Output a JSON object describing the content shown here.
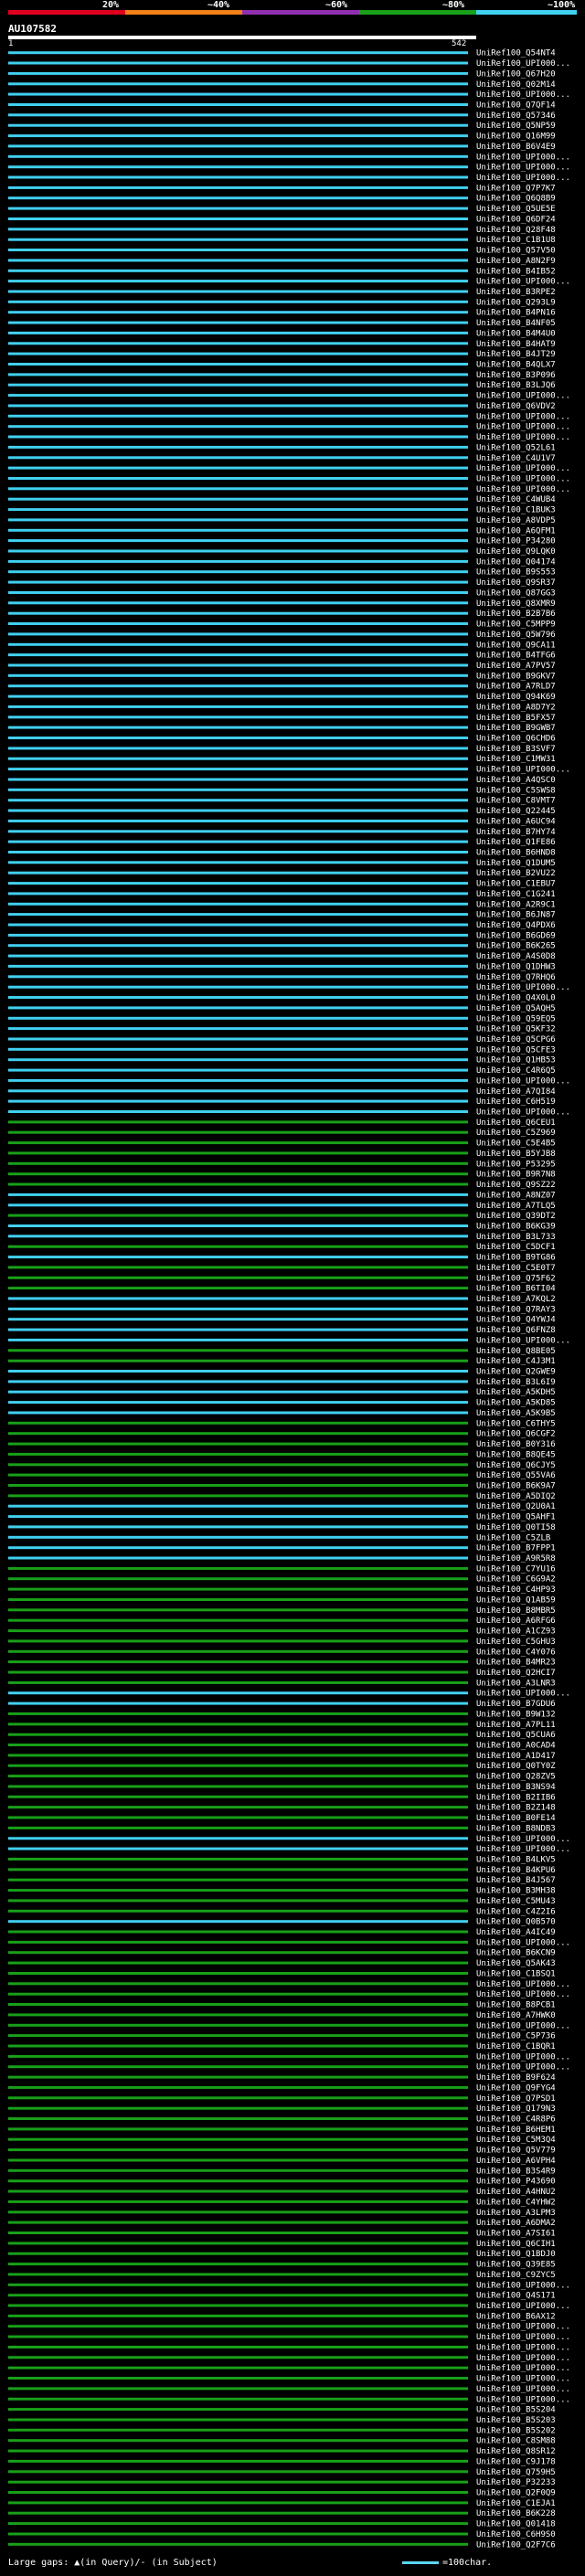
{
  "legend": {
    "ticks": [
      "20%",
      "~40%",
      "~60%",
      "~80%",
      "~100%"
    ],
    "colors": [
      "#e0001e",
      "#f08018",
      "#9030b0",
      "#18a018",
      "#40d0f0"
    ]
  },
  "query": {
    "name": "AU107582",
    "start": "1",
    "end": "542"
  },
  "footer": {
    "gaps": "Large gaps: ▲(in Query)/- (in Subject)",
    "scale": "=100char."
  },
  "hits": [
    {
      "name": "UniRef100_Q54NT4",
      "pct": 100
    },
    {
      "name": "UniRef100_UPI000...",
      "pct": 100
    },
    {
      "name": "UniRef100_Q67H20",
      "pct": 100
    },
    {
      "name": "UniRef100_Q02M14",
      "pct": 100
    },
    {
      "name": "UniRef100_UPI000...",
      "pct": 100
    },
    {
      "name": "UniRef100_Q7QF14",
      "pct": 100
    },
    {
      "name": "UniRef100_Q57346",
      "pct": 100
    },
    {
      "name": "UniRef100_Q5NP59",
      "pct": 100
    },
    {
      "name": "UniRef100_Q16M99",
      "pct": 100
    },
    {
      "name": "UniRef100_B6V4E9",
      "pct": 100
    },
    {
      "name": "UniRef100_UPI000...",
      "pct": 100
    },
    {
      "name": "UniRef100_UPI000...",
      "pct": 100
    },
    {
      "name": "UniRef100_UPI000...",
      "pct": 100
    },
    {
      "name": "UniRef100_Q7P7K7",
      "pct": 100
    },
    {
      "name": "UniRef100_Q6Q8B9",
      "pct": 100
    },
    {
      "name": "UniRef100_Q5UE5E",
      "pct": 100
    },
    {
      "name": "UniRef100_Q6DF24",
      "pct": 100
    },
    {
      "name": "UniRef100_Q28F48",
      "pct": 100
    },
    {
      "name": "UniRef100_C1B1U8",
      "pct": 100
    },
    {
      "name": "UniRef100_Q57V50",
      "pct": 100
    },
    {
      "name": "UniRef100_A8N2F9",
      "pct": 100
    },
    {
      "name": "UniRef100_B4IB52",
      "pct": 100
    },
    {
      "name": "UniRef100_UPI000...",
      "pct": 100
    },
    {
      "name": "UniRef100_B3RPE2",
      "pct": 100
    },
    {
      "name": "UniRef100_Q293L9",
      "pct": 100
    },
    {
      "name": "UniRef100_B4PN16",
      "pct": 100
    },
    {
      "name": "UniRef100_B4NF05",
      "pct": 100
    },
    {
      "name": "UniRef100_B4M4U0",
      "pct": 100
    },
    {
      "name": "UniRef100_B4HAT9",
      "pct": 100
    },
    {
      "name": "UniRef100_B4JT29",
      "pct": 100
    },
    {
      "name": "UniRef100_B4QLX7",
      "pct": 100
    },
    {
      "name": "UniRef100_B3P096",
      "pct": 100
    },
    {
      "name": "UniRef100_B3LJQ6",
      "pct": 100
    },
    {
      "name": "UniRef100_UPI000...",
      "pct": 100
    },
    {
      "name": "UniRef100_Q6VDV2",
      "pct": 100
    },
    {
      "name": "UniRef100_UPI000...",
      "pct": 100
    },
    {
      "name": "UniRef100_UPI000...",
      "pct": 100
    },
    {
      "name": "UniRef100_UPI000...",
      "pct": 100
    },
    {
      "name": "UniRef100_Q52L61",
      "pct": 100
    },
    {
      "name": "UniRef100_C4U1V7",
      "pct": 100
    },
    {
      "name": "UniRef100_UPI000...",
      "pct": 100
    },
    {
      "name": "UniRef100_UPI000...",
      "pct": 100
    },
    {
      "name": "UniRef100_UPI000...",
      "pct": 100
    },
    {
      "name": "UniRef100_C4WUB4",
      "pct": 100
    },
    {
      "name": "UniRef100_C1BUK3",
      "pct": 100
    },
    {
      "name": "UniRef100_A8VDP5",
      "pct": 100
    },
    {
      "name": "UniRef100_A6QFM1",
      "pct": 100
    },
    {
      "name": "UniRef100_P34280",
      "pct": 100
    },
    {
      "name": "UniRef100_Q9LQK0",
      "pct": 100
    },
    {
      "name": "UniRef100_Q04174",
      "pct": 100
    },
    {
      "name": "UniRef100_B9S553",
      "pct": 100
    },
    {
      "name": "UniRef100_Q9SR37",
      "pct": 100
    },
    {
      "name": "UniRef100_Q87GG3",
      "pct": 100
    },
    {
      "name": "UniRef100_Q8XMR9",
      "pct": 100
    },
    {
      "name": "UniRef100_B2B7B6",
      "pct": 100
    },
    {
      "name": "UniRef100_C5MPP9",
      "pct": 100
    },
    {
      "name": "UniRef100_Q5W796",
      "pct": 100
    },
    {
      "name": "UniRef100_Q9CA11",
      "pct": 100
    },
    {
      "name": "UniRef100_B4TFG6",
      "pct": 100
    },
    {
      "name": "UniRef100_A7PV57",
      "pct": 100
    },
    {
      "name": "UniRef100_B9GKV7",
      "pct": 100
    },
    {
      "name": "UniRef100_A7RLD7",
      "pct": 100
    },
    {
      "name": "UniRef100_Q94K69",
      "pct": 100
    },
    {
      "name": "UniRef100_A8D7Y2",
      "pct": 100
    },
    {
      "name": "UniRef100_B5FX57",
      "pct": 100
    },
    {
      "name": "UniRef100_B9GWB7",
      "pct": 100
    },
    {
      "name": "UniRef100_Q6CHD6",
      "pct": 100
    },
    {
      "name": "UniRef100_B3SVF7",
      "pct": 100
    },
    {
      "name": "UniRef100_C1MW31",
      "pct": 100
    },
    {
      "name": "UniRef100_UPI000...",
      "pct": 100
    },
    {
      "name": "UniRef100_A4QSC0",
      "pct": 100
    },
    {
      "name": "UniRef100_C5SWS8",
      "pct": 100
    },
    {
      "name": "UniRef100_C8VMT7",
      "pct": 100
    },
    {
      "name": "UniRef100_Q22445",
      "pct": 100
    },
    {
      "name": "UniRef100_A6UC94",
      "pct": 100
    },
    {
      "name": "UniRef100_B7HY74",
      "pct": 100
    },
    {
      "name": "UniRef100_Q1FE86",
      "pct": 100
    },
    {
      "name": "UniRef100_B6HND8",
      "pct": 100
    },
    {
      "name": "UniRef100_Q1DUM5",
      "pct": 100
    },
    {
      "name": "UniRef100_B2VU22",
      "pct": 100
    },
    {
      "name": "UniRef100_C1EBU7",
      "pct": 100
    },
    {
      "name": "UniRef100_C1G241",
      "pct": 100
    },
    {
      "name": "UniRef100_A2R9C1",
      "pct": 100
    },
    {
      "name": "UniRef100_B6JN87",
      "pct": 100
    },
    {
      "name": "UniRef100_Q4PDX6",
      "pct": 100
    },
    {
      "name": "UniRef100_B6GD69",
      "pct": 100
    },
    {
      "name": "UniRef100_B6K265",
      "pct": 100
    },
    {
      "name": "UniRef100_A4S0D8",
      "pct": 100
    },
    {
      "name": "UniRef100_Q1DHW3",
      "pct": 100
    },
    {
      "name": "UniRef100_Q7RHQ6",
      "pct": 100
    },
    {
      "name": "UniRef100_UPI000...",
      "pct": 100
    },
    {
      "name": "UniRef100_Q4X0L0",
      "pct": 100
    },
    {
      "name": "UniRef100_Q5AQH5",
      "pct": 100
    },
    {
      "name": "UniRef100_Q59EQ5",
      "pct": 100
    },
    {
      "name": "UniRef100_Q5KF32",
      "pct": 100
    },
    {
      "name": "UniRef100_Q5CPG6",
      "pct": 100
    },
    {
      "name": "UniRef100_Q5CFE3",
      "pct": 100
    },
    {
      "name": "UniRef100_Q1HB53",
      "pct": 100
    },
    {
      "name": "UniRef100_C4R6Q5",
      "pct": 100
    },
    {
      "name": "UniRef100_UPI000...",
      "pct": 100
    },
    {
      "name": "UniRef100_A7QI84",
      "pct": 100
    },
    {
      "name": "UniRef100_C6H519",
      "pct": 100
    },
    {
      "name": "UniRef100_UPI000...",
      "pct": 100
    },
    {
      "name": "UniRef100_Q6CEU1",
      "pct": 80
    },
    {
      "name": "UniRef100_C5Z969",
      "pct": 80
    },
    {
      "name": "UniRef100_C5E4B5",
      "pct": 80
    },
    {
      "name": "UniRef100_B5YJB8",
      "pct": 80
    },
    {
      "name": "UniRef100_P53295",
      "pct": 80
    },
    {
      "name": "UniRef100_B9R7N8",
      "pct": 80
    },
    {
      "name": "UniRef100_Q9SZ22",
      "pct": 80
    },
    {
      "name": "UniRef100_A8NZ07",
      "pct": 100
    },
    {
      "name": "UniRef100_A7TLQ5",
      "pct": 100
    },
    {
      "name": "UniRef100_Q39DT2",
      "pct": 80
    },
    {
      "name": "UniRef100_B6KG39",
      "pct": 100
    },
    {
      "name": "UniRef100_B3L733",
      "pct": 100
    },
    {
      "name": "UniRef100_C5DCF1",
      "pct": 80
    },
    {
      "name": "UniRef100_B9TG86",
      "pct": 100
    },
    {
      "name": "UniRef100_C5E0T7",
      "pct": 80
    },
    {
      "name": "UniRef100_Q75F62",
      "pct": 80
    },
    {
      "name": "UniRef100_B6TI04",
      "pct": 80
    },
    {
      "name": "UniRef100_A7KQL2",
      "pct": 100
    },
    {
      "name": "UniRef100_Q7RAY3",
      "pct": 100
    },
    {
      "name": "UniRef100_Q4YWJ4",
      "pct": 100
    },
    {
      "name": "UniRef100_Q6FNZ8",
      "pct": 100
    },
    {
      "name": "UniRef100_UPI000...",
      "pct": 100
    },
    {
      "name": "UniRef100_Q8BE05",
      "pct": 80
    },
    {
      "name": "UniRef100_C4J3M1",
      "pct": 80
    },
    {
      "name": "UniRef100_Q2GWE9",
      "pct": 100
    },
    {
      "name": "UniRef100_B3L6I9",
      "pct": 100
    },
    {
      "name": "UniRef100_A5KDH5",
      "pct": 100
    },
    {
      "name": "UniRef100_A5KD85",
      "pct": 100
    },
    {
      "name": "UniRef100_A5K9B5",
      "pct": 100
    },
    {
      "name": "UniRef100_C6THY5",
      "pct": 80
    },
    {
      "name": "UniRef100_Q6CGF2",
      "pct": 80
    },
    {
      "name": "UniRef100_B0Y316",
      "pct": 80
    },
    {
      "name": "UniRef100_B8QE45",
      "pct": 80
    },
    {
      "name": "UniRef100_Q6CJY5",
      "pct": 80
    },
    {
      "name": "UniRef100_Q55VA6",
      "pct": 80
    },
    {
      "name": "UniRef100_B6K9A7",
      "pct": 80
    },
    {
      "name": "UniRef100_A5DIQ2",
      "pct": 80
    },
    {
      "name": "UniRef100_Q2U0A1",
      "pct": 100
    },
    {
      "name": "UniRef100_Q5AHF1",
      "pct": 100
    },
    {
      "name": "UniRef100_Q0TI58",
      "pct": 100
    },
    {
      "name": "UniRef100_C5ZLB",
      "pct": 100
    },
    {
      "name": "UniRef100_B7FPP1",
      "pct": 100
    },
    {
      "name": "UniRef100_A9R5R8",
      "pct": 100
    },
    {
      "name": "UniRef100_C7YU16",
      "pct": 80
    },
    {
      "name": "UniRef100_C6G9A2",
      "pct": 80
    },
    {
      "name": "UniRef100_C4HP93",
      "pct": 80
    },
    {
      "name": "UniRef100_Q1AB59",
      "pct": 80
    },
    {
      "name": "UniRef100_B8MBR5",
      "pct": 80
    },
    {
      "name": "UniRef100_A6RFG6",
      "pct": 80
    },
    {
      "name": "UniRef100_A1CZ93",
      "pct": 80
    },
    {
      "name": "UniRef100_C5GHU3",
      "pct": 80
    },
    {
      "name": "UniRef100_C4Y076",
      "pct": 80
    },
    {
      "name": "UniRef100_B4MR23",
      "pct": 80
    },
    {
      "name": "UniRef100_Q2HCI7",
      "pct": 80
    },
    {
      "name": "UniRef100_A3LNR3",
      "pct": 80
    },
    {
      "name": "UniRef100_UPI000...",
      "pct": 100
    },
    {
      "name": "UniRef100_B7GDU6",
      "pct": 100
    },
    {
      "name": "UniRef100_B9W132",
      "pct": 80
    },
    {
      "name": "UniRef100_A7PL11",
      "pct": 80
    },
    {
      "name": "UniRef100_Q5CUA6",
      "pct": 80
    },
    {
      "name": "UniRef100_A0CAD4",
      "pct": 80
    },
    {
      "name": "UniRef100_A1D417",
      "pct": 80
    },
    {
      "name": "UniRef100_Q0TY0Z",
      "pct": 80
    },
    {
      "name": "UniRef100_Q28ZV5",
      "pct": 80
    },
    {
      "name": "UniRef100_B3NS94",
      "pct": 80
    },
    {
      "name": "UniRef100_B2IIB6",
      "pct": 80
    },
    {
      "name": "UniRef100_B2Z148",
      "pct": 80
    },
    {
      "name": "UniRef100_B0FE14",
      "pct": 80
    },
    {
      "name": "UniRef100_B8NDB3",
      "pct": 80
    },
    {
      "name": "UniRef100_UPI000...",
      "pct": 100
    },
    {
      "name": "UniRef100_UPI000...",
      "pct": 100
    },
    {
      "name": "UniRef100_B4LKV5",
      "pct": 80
    },
    {
      "name": "UniRef100_B4KPU6",
      "pct": 80
    },
    {
      "name": "UniRef100_B4J567",
      "pct": 80
    },
    {
      "name": "UniRef100_B3MH38",
      "pct": 80
    },
    {
      "name": "UniRef100_C5MU43",
      "pct": 80
    },
    {
      "name": "UniRef100_C4Z2I6",
      "pct": 80
    },
    {
      "name": "UniRef100_Q0B570",
      "pct": 100
    },
    {
      "name": "UniRef100_A4IC49",
      "pct": 80
    },
    {
      "name": "UniRef100_UPI000...",
      "pct": 80
    },
    {
      "name": "UniRef100_B6KCN9",
      "pct": 80
    },
    {
      "name": "UniRef100_Q5AK43",
      "pct": 80
    },
    {
      "name": "UniRef100_C1BSQ1",
      "pct": 80
    },
    {
      "name": "UniRef100_UPI000...",
      "pct": 80
    },
    {
      "name": "UniRef100_UPI000...",
      "pct": 80
    },
    {
      "name": "UniRef100_B8PCB1",
      "pct": 80
    },
    {
      "name": "UniRef100_A7HWK0",
      "pct": 80
    },
    {
      "name": "UniRef100_UPI000...",
      "pct": 80
    },
    {
      "name": "UniRef100_C5P736",
      "pct": 80
    },
    {
      "name": "UniRef100_C1BQR1",
      "pct": 80
    },
    {
      "name": "UniRef100_UPI000...",
      "pct": 80
    },
    {
      "name": "UniRef100_UPI000...",
      "pct": 80
    },
    {
      "name": "UniRef100_B9F624",
      "pct": 80
    },
    {
      "name": "UniRef100_Q9FYG4",
      "pct": 80
    },
    {
      "name": "UniRef100_Q7PSD1",
      "pct": 80
    },
    {
      "name": "UniRef100_Q179N3",
      "pct": 80
    },
    {
      "name": "UniRef100_C4R8P6",
      "pct": 80
    },
    {
      "name": "UniRef100_B6HEM1",
      "pct": 80
    },
    {
      "name": "UniRef100_C5M3Q4",
      "pct": 80
    },
    {
      "name": "UniRef100_Q5V779",
      "pct": 80
    },
    {
      "name": "UniRef100_A6VPH4",
      "pct": 80
    },
    {
      "name": "UniRef100_B3S4R9",
      "pct": 80
    },
    {
      "name": "UniRef100_P43690",
      "pct": 80
    },
    {
      "name": "UniRef100_A4HNU2",
      "pct": 80
    },
    {
      "name": "UniRef100_C4YHW2",
      "pct": 80
    },
    {
      "name": "UniRef100_A3LPM3",
      "pct": 80
    },
    {
      "name": "UniRef100_A6DMA2",
      "pct": 80
    },
    {
      "name": "UniRef100_A7SI61",
      "pct": 80
    },
    {
      "name": "UniRef100_Q6CIH1",
      "pct": 80
    },
    {
      "name": "UniRef100_Q1BDJ0",
      "pct": 80
    },
    {
      "name": "UniRef100_Q39E85",
      "pct": 80
    },
    {
      "name": "UniRef100_C9ZYC5",
      "pct": 80
    },
    {
      "name": "UniRef100_UPI000...",
      "pct": 80
    },
    {
      "name": "UniRef100_Q4S171",
      "pct": 80
    },
    {
      "name": "UniRef100_UPI000...",
      "pct": 80
    },
    {
      "name": "UniRef100_B6AX12",
      "pct": 80
    },
    {
      "name": "UniRef100_UPI000...",
      "pct": 80
    },
    {
      "name": "UniRef100_UPI000...",
      "pct": 80
    },
    {
      "name": "UniRef100_UPI000...",
      "pct": 80
    },
    {
      "name": "UniRef100_UPI000...",
      "pct": 80
    },
    {
      "name": "UniRef100_UPI000...",
      "pct": 80
    },
    {
      "name": "UniRef100_UPI000...",
      "pct": 80
    },
    {
      "name": "UniRef100_UPI000...",
      "pct": 80
    },
    {
      "name": "UniRef100_UPI000...",
      "pct": 80
    },
    {
      "name": "UniRef100_B5S204",
      "pct": 80
    },
    {
      "name": "UniRef100_B5S203",
      "pct": 80
    },
    {
      "name": "UniRef100_B5S202",
      "pct": 80
    },
    {
      "name": "UniRef100_C8SM88",
      "pct": 80
    },
    {
      "name": "UniRef100_Q8SR12",
      "pct": 80
    },
    {
      "name": "UniRef100_C9J178",
      "pct": 80
    },
    {
      "name": "UniRef100_Q759H5",
      "pct": 80
    },
    {
      "name": "UniRef100_P32233",
      "pct": 80
    },
    {
      "name": "UniRef100_Q2F0Q9",
      "pct": 80
    },
    {
      "name": "UniRef100_C1EJA1",
      "pct": 80
    },
    {
      "name": "UniRef100_B6K228",
      "pct": 80
    },
    {
      "name": "UniRef100_Q01418",
      "pct": 80
    },
    {
      "name": "UniRef100_C6H9S0",
      "pct": 80
    },
    {
      "name": "UniRef100_Q2F7C6",
      "pct": 80
    }
  ]
}
